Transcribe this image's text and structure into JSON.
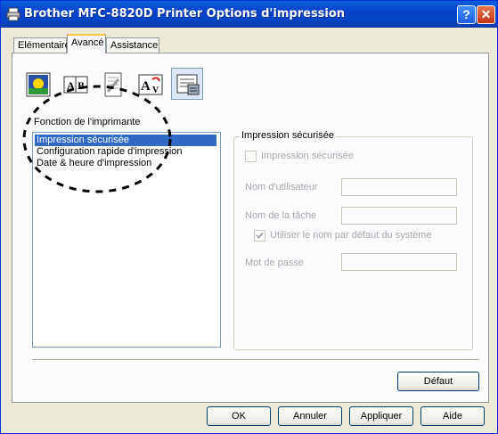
{
  "window": {
    "title": "Brother MFC-8820D Printer Options d'impression",
    "help_button": "?",
    "close_button": "✕"
  },
  "tabs": [
    {
      "label": "Elémentaire"
    },
    {
      "label": "Avancé"
    },
    {
      "label": "Assistance"
    }
  ],
  "toolbar_icons": [
    "quality-color-icon",
    "duplex-layout-icon",
    "watermark-icon",
    "page-settings-icon",
    "device-options-icon"
  ],
  "function_list": {
    "label": "Fonction de l'imprimante",
    "items": [
      "Impression sécurisée",
      "Configuration rapide d'impression",
      "Date & heure d'impression"
    ],
    "selected_index": 0
  },
  "secure_print": {
    "group_title": "Impression sécurisée",
    "checkbox_label": "Impression sécurisée",
    "user_name_label": "Nom d'utilisateur",
    "job_name_label": "Nom de la tâche",
    "default_name_label": "Utiliser le nom par défaut du système",
    "password_label": "Mot de passe"
  },
  "buttons": {
    "default": "Défaut",
    "ok": "OK",
    "cancel": "Annuler",
    "apply": "Appliquer",
    "help": "Aide"
  }
}
